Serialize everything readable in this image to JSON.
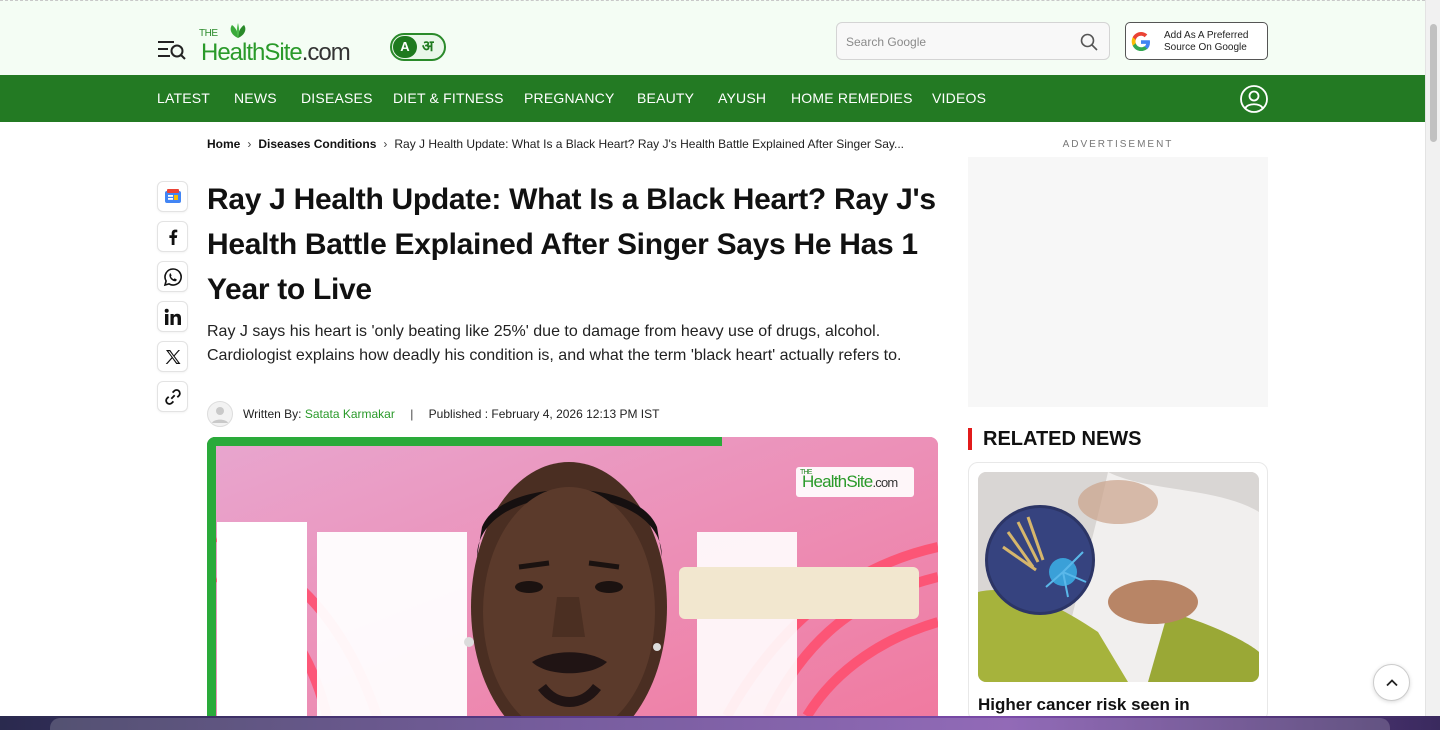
{
  "header": {
    "logo": {
      "the": "THE",
      "health": "HealthSite",
      "dotcom": ".com"
    },
    "lang_en": "A",
    "lang_hi": "अ",
    "search_placeholder": "Search Google",
    "google_source_line1": "Add As A Preferred",
    "google_source_line2": "Source On Google"
  },
  "nav": {
    "items": [
      "LATEST",
      "NEWS",
      "DISEASES",
      "DIET & FITNESS",
      "PREGNANCY",
      "BEAUTY",
      "AYUSH",
      "HOME REMEDIES",
      "VIDEOS"
    ]
  },
  "breadcrumb": {
    "home": "Home",
    "section": "Diseases Conditions",
    "current": "Ray J Health Update: What Is a Black Heart? Ray J's Health Battle Explained After Singer Say..."
  },
  "article": {
    "title": "Ray J Health Update: What Is a Black Heart? Ray J's Health Battle Explained After Singer Says He Has 1 Year to Live",
    "summary": "Ray J says his heart is 'only beating like 25%' due to damage from heavy use of drugs, alcohol. Cardiologist explains how deadly his condition is, and what the term 'black heart' actually refers to.",
    "written_by_label": "Written By:",
    "author": "Satata Karmakar",
    "published_label": "Published :",
    "published_date": "February 4, 2026 12:13 PM IST",
    "hero_watermark": {
      "the": "THE",
      "health": "HealthSite",
      "dotcom": ".com"
    }
  },
  "share_icons": [
    "google-news-icon",
    "facebook-icon",
    "whatsapp-icon",
    "linkedin-icon",
    "x-icon",
    "copy-link-icon"
  ],
  "sidebar": {
    "ad_label": "ADVERTISEMENT",
    "related_heading": "RELATED NEWS",
    "related_items": [
      {
        "headline": "Higher cancer risk seen in"
      }
    ]
  },
  "colors": {
    "brand_green": "#237a23",
    "header_bg": "#f4fdf4",
    "accent_red": "#e21b1b",
    "author_link": "#2a9a2a"
  }
}
